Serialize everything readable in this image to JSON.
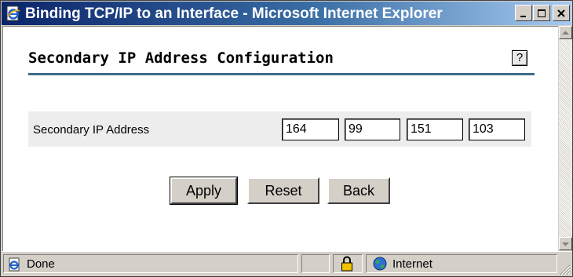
{
  "window": {
    "title": "Binding TCP/IP to an Interface - Microsoft Internet Explorer",
    "controls": [
      "minimize",
      "maximize",
      "close"
    ]
  },
  "page": {
    "heading": "Secondary IP Address Configuration",
    "help_glyph": "?",
    "field_label": "Secondary IP Address",
    "ip_octets": [
      "164",
      "99",
      "151",
      "103"
    ],
    "buttons": {
      "apply": "Apply",
      "reset": "Reset",
      "back": "Back"
    }
  },
  "status_bar": {
    "status": "Done",
    "zone": "Internet"
  },
  "colors": {
    "title_gradient_start": "#0a246a",
    "title_gradient_end": "#a6caf0",
    "heading_rule": "#3e6b8a",
    "panel_bg": "#ededed"
  },
  "icons": [
    "ie-page-icon",
    "minimize-icon",
    "maximize-icon",
    "close-icon",
    "help-icon",
    "lock-icon",
    "internet-globe-icon"
  ]
}
